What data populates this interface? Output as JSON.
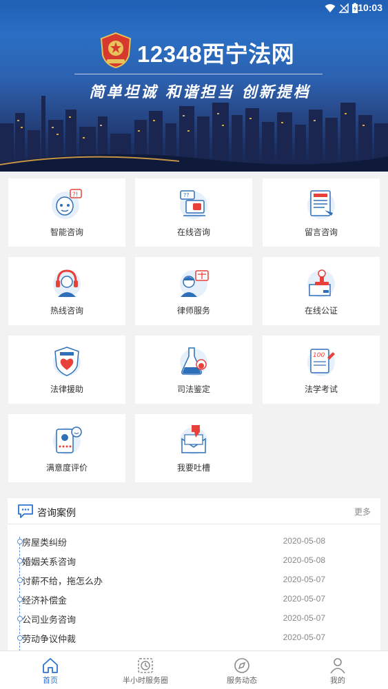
{
  "status_bar": {
    "time": "10:03"
  },
  "header": {
    "title": "12348西宁法网",
    "slogan": "简单坦诚  和谐担当  创新提档"
  },
  "services": [
    {
      "label": "智能咨询",
      "icon": "robot-consult-icon"
    },
    {
      "label": "在线咨询",
      "icon": "online-chat-icon"
    },
    {
      "label": "留言咨询",
      "icon": "message-board-icon"
    },
    {
      "label": "热线咨询",
      "icon": "hotline-agent-icon"
    },
    {
      "label": "律师服务",
      "icon": "lawyer-icon"
    },
    {
      "label": "在线公证",
      "icon": "notary-stamp-icon"
    },
    {
      "label": "法律援助",
      "icon": "legal-aid-shield-icon"
    },
    {
      "label": "司法鉴定",
      "icon": "lab-flask-icon"
    },
    {
      "label": "法学考试",
      "icon": "exam-paper-icon"
    },
    {
      "label": "满意度评价",
      "icon": "rating-card-icon"
    },
    {
      "label": "我要吐槽",
      "icon": "complaint-thumbdown-icon"
    }
  ],
  "cases": {
    "title": "咨询案例",
    "more_label": "更多",
    "items": [
      {
        "name": "房屋类纠纷",
        "date": "2020-05-08"
      },
      {
        "name": "婚姻关系咨询",
        "date": "2020-05-08"
      },
      {
        "name": "讨薪不给，拖怎么办",
        "date": "2020-05-07"
      },
      {
        "name": "经济补偿金",
        "date": "2020-05-07"
      },
      {
        "name": "公司业务咨询",
        "date": "2020-05-07"
      },
      {
        "name": "劳动争议仲裁",
        "date": "2020-05-07"
      }
    ]
  },
  "bottom_nav": [
    {
      "label": "首页",
      "icon": "home-icon",
      "active": true
    },
    {
      "label": "半小时服务圈",
      "icon": "clock-icon",
      "active": false
    },
    {
      "label": "服务动态",
      "icon": "compass-icon",
      "active": false
    },
    {
      "label": "我的",
      "icon": "user-icon",
      "active": false
    }
  ],
  "colors": {
    "accent": "#2b73d0",
    "icon_red": "#e8413a",
    "icon_blue": "#2f6fb8"
  }
}
